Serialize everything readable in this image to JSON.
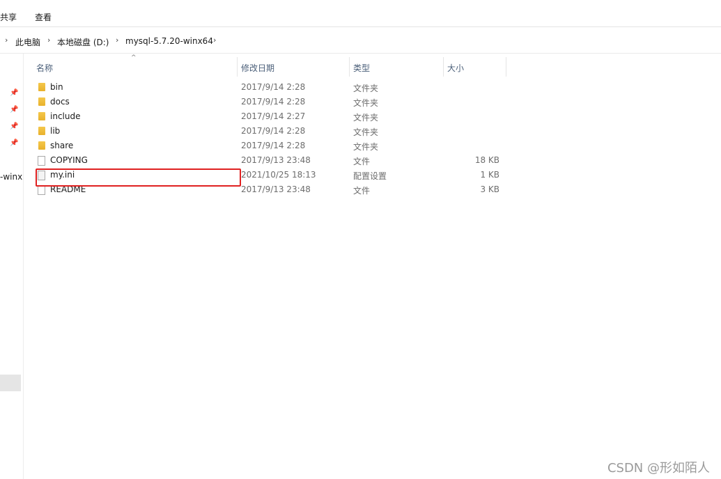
{
  "ribbon": {
    "tab_share": "共享",
    "tab_view": "查看"
  },
  "breadcrumb": [
    "此电脑",
    "本地磁盘 (D:)",
    "mysql-5.7.20-winx64"
  ],
  "nav": {
    "partial_label": "-winx"
  },
  "columns": {
    "name": "名称",
    "date": "修改日期",
    "type": "类型",
    "size": "大小"
  },
  "files": [
    {
      "name": "bin",
      "date": "2017/9/14 2:28",
      "type": "文件夹",
      "size": "",
      "kind": "folder"
    },
    {
      "name": "docs",
      "date": "2017/9/14 2:28",
      "type": "文件夹",
      "size": "",
      "kind": "folder"
    },
    {
      "name": "include",
      "date": "2017/9/14 2:27",
      "type": "文件夹",
      "size": "",
      "kind": "folder"
    },
    {
      "name": "lib",
      "date": "2017/9/14 2:28",
      "type": "文件夹",
      "size": "",
      "kind": "folder"
    },
    {
      "name": "share",
      "date": "2017/9/14 2:28",
      "type": "文件夹",
      "size": "",
      "kind": "folder"
    },
    {
      "name": "COPYING",
      "date": "2017/9/13 23:48",
      "type": "文件",
      "size": "18 KB",
      "kind": "file"
    },
    {
      "name": "my.ini",
      "date": "2021/10/25 18:13",
      "type": "配置设置",
      "size": "1 KB",
      "kind": "ini"
    },
    {
      "name": "README",
      "date": "2017/9/13 23:48",
      "type": "文件",
      "size": "3 KB",
      "kind": "file"
    }
  ],
  "watermark": "CSDN @形如陌人",
  "colors": {
    "highlight": "#e02020",
    "folder": "#f5c84c"
  },
  "icons": {
    "pin": "pin-icon",
    "chevron": "chevron-right-icon"
  }
}
